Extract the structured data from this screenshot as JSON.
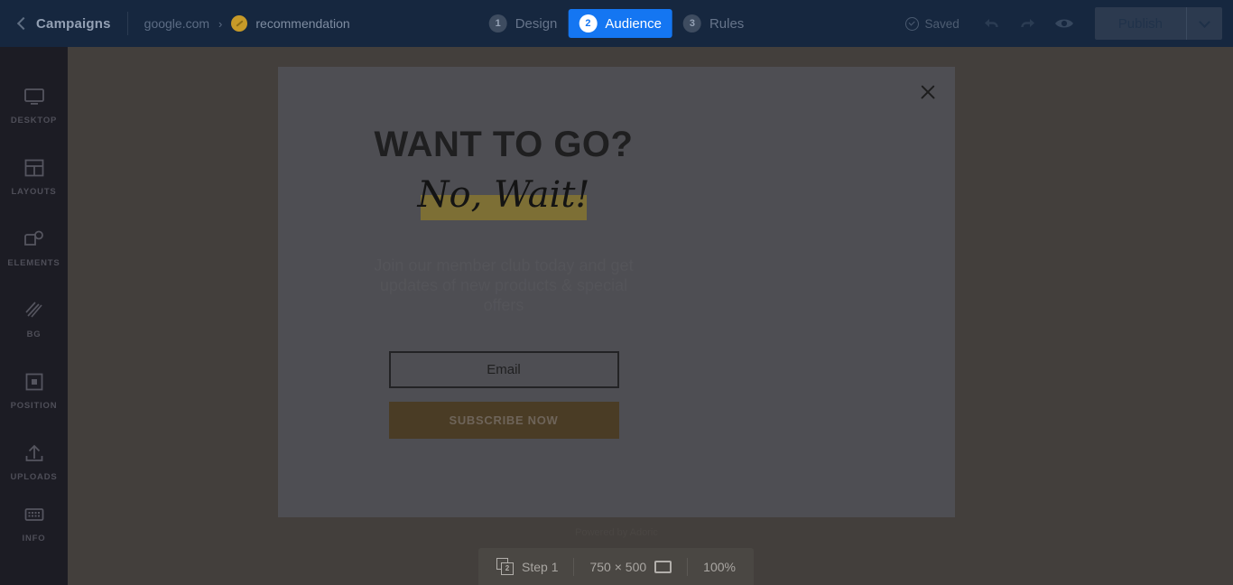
{
  "header": {
    "back_icon": "chevron-left-icon",
    "campaigns_label": "Campaigns",
    "domain": "google.com",
    "crumb_arrow": "›",
    "campaign_name": "recommendation",
    "steps": [
      {
        "num": "1",
        "label": "Design",
        "active": false
      },
      {
        "num": "2",
        "label": "Audience",
        "active": true
      },
      {
        "num": "3",
        "label": "Rules",
        "active": false
      }
    ],
    "saved_label": "Saved",
    "undo_icon": "undo-icon",
    "redo_icon": "redo-icon",
    "preview_icon": "eye-icon",
    "publish_label": "Publish",
    "publish_caret_icon": "chevron-down-icon"
  },
  "sidebar": {
    "items": [
      {
        "icon": "desktop-icon",
        "label": "DESKTOP"
      },
      {
        "icon": "layouts-icon",
        "label": "LAYOUTS"
      },
      {
        "icon": "elements-icon",
        "label": "ELEMENTS"
      },
      {
        "icon": "bg-icon",
        "label": "BG"
      },
      {
        "icon": "position-icon",
        "label": "POSITION"
      },
      {
        "icon": "uploads-icon",
        "label": "UPLOADS"
      }
    ],
    "bottom_item": {
      "icon": "info-icon",
      "label": "INFO"
    }
  },
  "popup": {
    "close_icon": "close-icon",
    "headline": "WANT TO GO?",
    "script_line": "No, Wait!",
    "body_text": "Join our member club today and get updates of new products & special offers",
    "email_placeholder": "Email",
    "email_value": "",
    "subscribe_label": "SUBSCRIBE NOW",
    "highlight_color": "#7d6f35",
    "button_color": "#4a3c25"
  },
  "canvas": {
    "powered_by": "Powered by Adoric"
  },
  "bottombar": {
    "layers_count": "2",
    "layers_icon": "layers-icon",
    "step_label": "Step 1",
    "dimensions": "750 × 500",
    "rect_icon": "rectangle-icon",
    "zoom_level": "100%"
  }
}
